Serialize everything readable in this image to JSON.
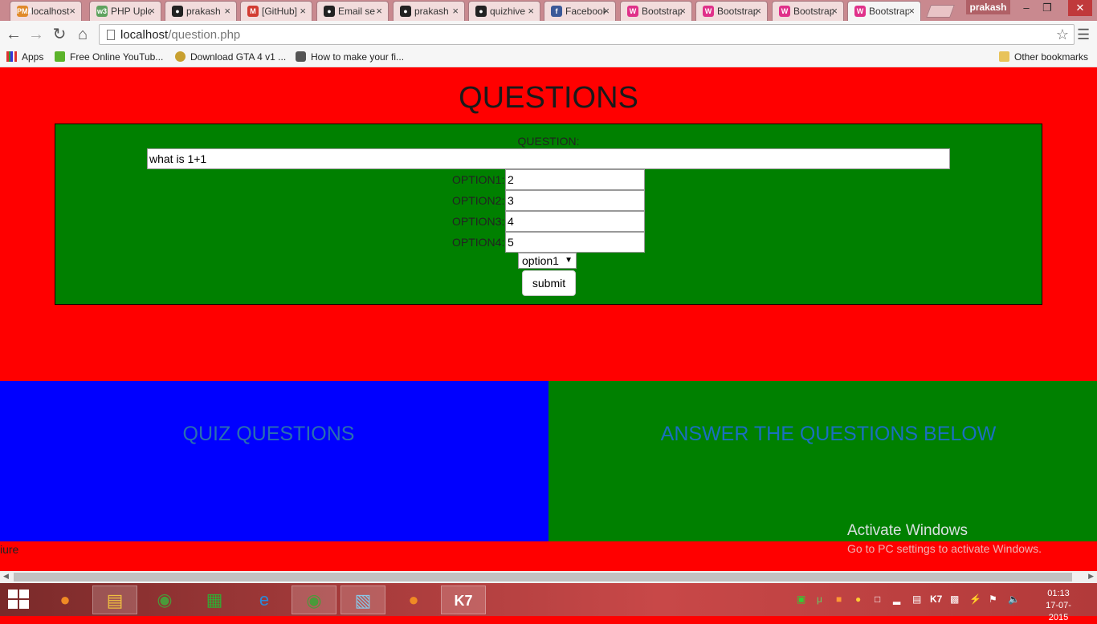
{
  "browser": {
    "tabs": [
      {
        "title": "localhost",
        "icon": "phpmyadmin-icon",
        "color": "#e08a2a",
        "glyph": "PMA"
      },
      {
        "title": "PHP Upload",
        "icon": "w3schools-icon",
        "color": "#5fa35f",
        "glyph": "w3"
      },
      {
        "title": "prakash",
        "icon": "github-icon",
        "color": "#222222",
        "glyph": "●"
      },
      {
        "title": "[GitHub]",
        "icon": "gmail-icon",
        "color": "#d23c32",
        "glyph": "M"
      },
      {
        "title": "Email se",
        "icon": "github-icon",
        "color": "#222222",
        "glyph": "●"
      },
      {
        "title": "prakash",
        "icon": "github-icon",
        "color": "#222222",
        "glyph": "●"
      },
      {
        "title": "quizhive",
        "icon": "github-icon",
        "color": "#222222",
        "glyph": "●"
      },
      {
        "title": "Facebook",
        "icon": "facebook-icon",
        "color": "#3b5998",
        "glyph": "f"
      },
      {
        "title": "Bootstrap",
        "icon": "w3schools-icon",
        "color": "#e0318a",
        "glyph": "W"
      },
      {
        "title": "Bootstrap",
        "icon": "w3schools-icon",
        "color": "#e0318a",
        "glyph": "W"
      },
      {
        "title": "Bootstrap",
        "icon": "w3schools-icon",
        "color": "#e0318a",
        "glyph": "W"
      },
      {
        "title": "Bootstrap",
        "icon": "w3schools-icon",
        "color": "#e0318a",
        "glyph": "W"
      }
    ],
    "active_tab": 11,
    "profile": "prakash",
    "url_host": "localhost",
    "url_path": "/question.php"
  },
  "bookmarks": {
    "apps": "Apps",
    "items": [
      "Free Online YouTub...",
      "Download GTA 4 v1 ...",
      "How to make your fi..."
    ],
    "other": "Other bookmarks"
  },
  "page": {
    "title": "QUESTIONS",
    "question_label": "QUESTION:",
    "question_value": "what is 1+1",
    "options": [
      {
        "label": "OPTION1:",
        "value": "2"
      },
      {
        "label": "OPTION2:",
        "value": "3"
      },
      {
        "label": "OPTION3:",
        "value": "4"
      },
      {
        "label": "OPTION4:",
        "value": "5"
      }
    ],
    "answer_select": "option1",
    "submit_label": "submit",
    "quiz_panel_title": "QUIZ QUESTIONS",
    "answer_panel_title": "ANSWER THE QUESTIONS BELOW",
    "footer_fragment": "iure"
  },
  "watermark": {
    "line1": "Activate Windows",
    "line2": "Go to PC settings to activate Windows."
  },
  "taskbar": {
    "time": "01:13",
    "date": "17-07-2015"
  },
  "colors": {
    "page_bg": "#ff0000",
    "form_bg": "#008000",
    "quiz_panel_bg": "#0000ff",
    "answer_panel_bg": "#008000"
  }
}
